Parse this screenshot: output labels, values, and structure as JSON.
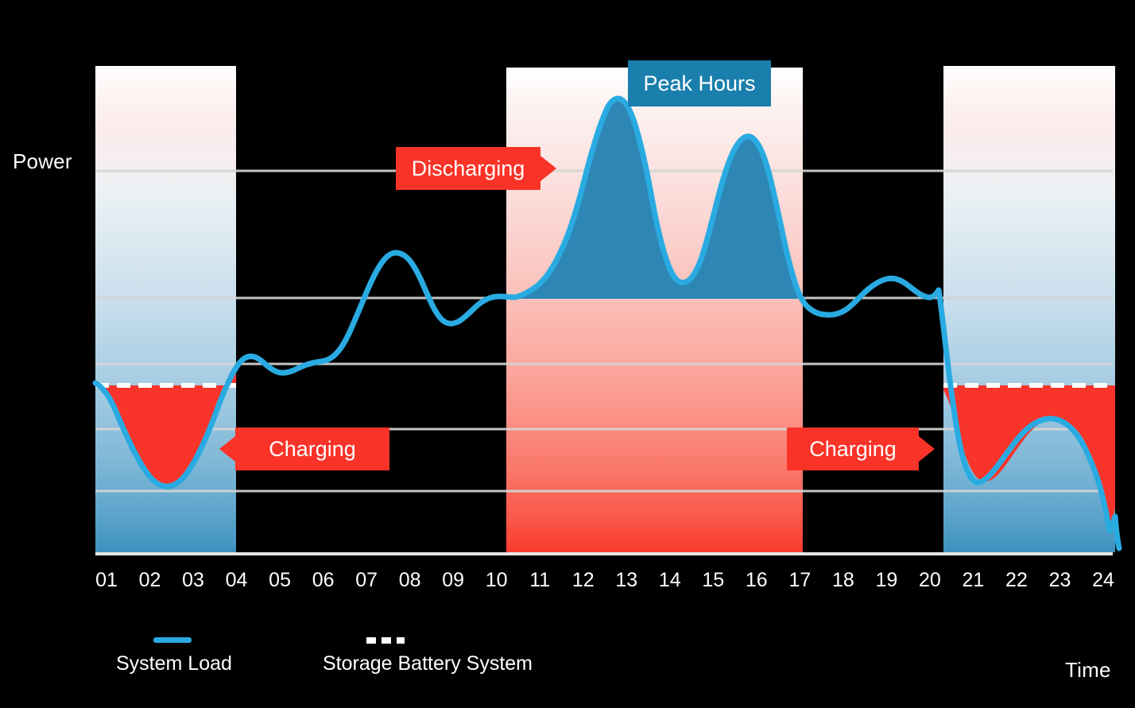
{
  "axes": {
    "y_label": "Power",
    "x_label": "Time",
    "x_ticks": [
      "01",
      "02",
      "03",
      "04",
      "05",
      "06",
      "07",
      "08",
      "09",
      "10",
      "11",
      "12",
      "13",
      "14",
      "15",
      "16",
      "17",
      "18",
      "19",
      "20",
      "21",
      "22",
      "23",
      "24"
    ]
  },
  "legend": {
    "items": [
      {
        "label": "System Load",
        "marker": "solid-line",
        "color": "#29ABE2"
      },
      {
        "label": "Storage Battery System",
        "marker": "dashed-line",
        "color": "#FFFFFF"
      }
    ]
  },
  "annotations": {
    "discharging": "Discharging",
    "charging_left": "Charging",
    "charging_right": "Charging",
    "peak_hours": "Peak Hours"
  },
  "colors": {
    "background": "#000000",
    "system_load_line": "#29ABE2",
    "charging_fill": "#FA3328",
    "discharging_fill": "#2E86B5",
    "peak_badge": "#1A7FAC",
    "gridline": "#D8D8D8",
    "battery_line": "#FFFFFF"
  },
  "chart_data": {
    "type": "area",
    "title": "",
    "subtitle": "",
    "xlabel": "Time",
    "ylabel": "Power",
    "grid": true,
    "legend_position": "bottom-left",
    "xlim": [
      0,
      24
    ],
    "ylim": [
      0,
      1
    ],
    "x_tick_labels": [
      "01",
      "02",
      "03",
      "04",
      "05",
      "06",
      "07",
      "08",
      "09",
      "10",
      "11",
      "12",
      "13",
      "14",
      "15",
      "16",
      "17",
      "18",
      "19",
      "20",
      "21",
      "22",
      "23",
      "24"
    ],
    "y_tick_labels": [],
    "gridline_levels": [
      0.76,
      0.43,
      0.26,
      0.17,
      0.0
    ],
    "battery_baseline_level": 0.44,
    "discharge_baseline_level": 0.67,
    "series": [
      {
        "name": "System Load",
        "type": "line",
        "color": "#29ABE2",
        "x": [
          1,
          2,
          3,
          4,
          5,
          6,
          7,
          8,
          9,
          10,
          11,
          12,
          13,
          14,
          15,
          16,
          17,
          18,
          19,
          20,
          21,
          22,
          23,
          24
        ],
        "values": [
          0.39,
          0.19,
          0.18,
          0.46,
          0.5,
          0.48,
          0.62,
          0.72,
          0.66,
          0.58,
          0.68,
          0.88,
          0.97,
          0.74,
          0.82,
          0.92,
          0.7,
          0.56,
          0.65,
          0.72,
          0.19,
          0.27,
          0.33,
          0.0
        ]
      },
      {
        "name": "Storage Battery System",
        "type": "dashed-baseline",
        "color": "#FFFFFF",
        "x": [
          1,
          4,
          21,
          24
        ],
        "values": [
          0.44,
          0.44,
          0.44,
          0.44
        ]
      }
    ],
    "regions": [
      {
        "name": "Charging Period 1",
        "label": "Charging",
        "x_start": 1,
        "x_end": 4,
        "fill": "#FA3328",
        "band_gradient": "white-to-blue"
      },
      {
        "name": "Peak Hours",
        "label": "Peak Hours",
        "x_start": 10,
        "x_end": 17,
        "fill": "#FA3328",
        "band_gradient": "white-to-red"
      },
      {
        "name": "Charging Period 2",
        "label": "Charging",
        "x_start": 21,
        "x_end": 24,
        "fill": "#FA3328",
        "band_gradient": "white-to-blue"
      }
    ],
    "annotations": [
      {
        "text": "Discharging",
        "x": 9.2,
        "y": 0.78,
        "style": "red-badge-arrow-right"
      },
      {
        "text": "Charging",
        "x": 5.5,
        "y": 0.24,
        "style": "red-badge-arrow-left"
      },
      {
        "text": "Charging",
        "x": 17.5,
        "y": 0.24,
        "style": "red-badge-arrow-right"
      },
      {
        "text": "Peak Hours",
        "x": 13.5,
        "y": 1.02,
        "style": "blue-badge"
      }
    ]
  }
}
